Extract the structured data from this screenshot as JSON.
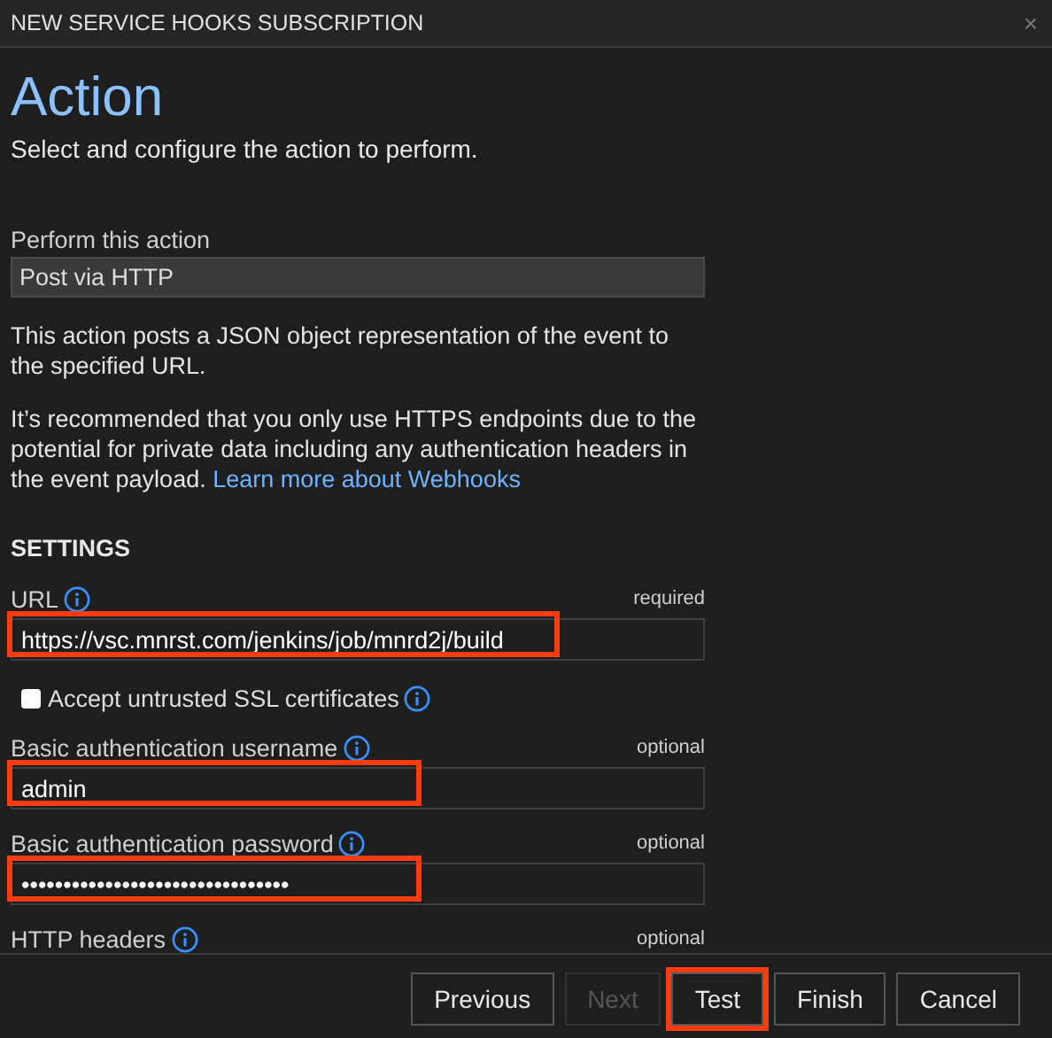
{
  "window": {
    "title": "NEW SERVICE HOOKS SUBSCRIPTION",
    "close": "×"
  },
  "heading": "Action",
  "subtitle": "Select and configure the action to perform.",
  "action_select": {
    "label": "Perform this action",
    "value": "Post via HTTP"
  },
  "description": "This action posts a JSON object representation of the event to the specified URL.",
  "warning": {
    "text": "It’s recommended that you only use HTTPS endpoints due to the potential for private data including any authentication headers in the event payload.",
    "link": "Learn more about Webhooks"
  },
  "settings": {
    "title": "SETTINGS",
    "fields": [
      {
        "kind": "text",
        "label": "URL",
        "note": "required",
        "value": "https://vsc.mnrst.com/jenkins/job/mnrd2j/build",
        "highlighted": true
      },
      {
        "kind": "checkbox",
        "label": "Accept untrusted SSL certificates",
        "checked": false
      },
      {
        "kind": "text",
        "label": "Basic authentication username",
        "note": "optional",
        "value": "admin",
        "highlighted": true
      },
      {
        "kind": "text",
        "label": "Basic authentication password",
        "note": "optional",
        "value": "••••••••••••••••••••••••••••••••",
        "highlighted": true
      },
      {
        "kind": "text",
        "label": "HTTP headers",
        "note": "optional"
      }
    ]
  },
  "buttons": [
    {
      "label": "Previous",
      "disabled": false,
      "highlighted": false
    },
    {
      "label": "Next",
      "disabled": true,
      "highlighted": false
    },
    {
      "label": "Test",
      "disabled": false,
      "highlighted": true
    },
    {
      "label": "Finish",
      "disabled": false,
      "highlighted": false
    },
    {
      "label": "Cancel",
      "disabled": false,
      "highlighted": false
    }
  ]
}
